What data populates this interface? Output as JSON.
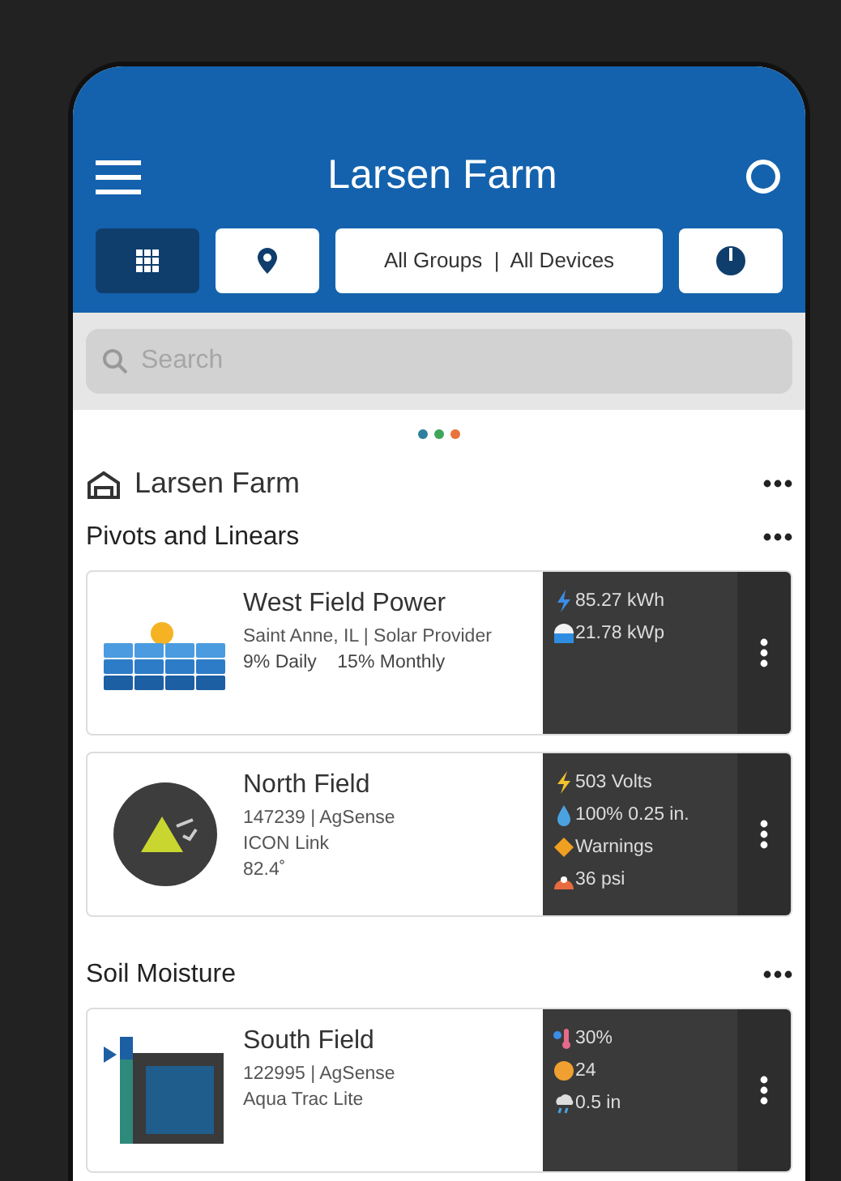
{
  "header": {
    "title": "Larsen Farm"
  },
  "toolbar": {
    "views": [
      {
        "kind": "grid",
        "selected": true
      },
      {
        "kind": "map",
        "selected": false
      }
    ],
    "filter": "All Groups  |  All Devices"
  },
  "search": {
    "placeholder": "Search"
  },
  "page_dots": [
    {
      "color": "#2f7f9e"
    },
    {
      "color": "#3fa558"
    },
    {
      "color": "#e8743b"
    }
  ],
  "farm": {
    "name": "Larsen Farm"
  },
  "sections": [
    {
      "title": "Pivots and Linears",
      "devices": [
        {
          "kind": "solar",
          "name": "West Field Power",
          "lines": [
            "Saint Anne, IL  |  Solar Provider"
          ],
          "stats": "9% Daily    15% Monthly",
          "readings": [
            {
              "kind": "energy",
              "text": "85.27 kWh"
            },
            {
              "kind": "peak",
              "text": "21.78 kWp"
            }
          ]
        },
        {
          "kind": "pivot",
          "name": "North Field",
          "lines": [
            "147239  |  AgSense",
            "ICON Link",
            "82.4˚"
          ],
          "readings": [
            {
              "kind": "volts",
              "text": "503 Volts"
            },
            {
              "kind": "water",
              "text": "100% 0.25 in."
            },
            {
              "kind": "warning",
              "text": "Warnings"
            },
            {
              "kind": "pressure",
              "text": "36 psi"
            }
          ]
        }
      ]
    },
    {
      "title": "Soil Moisture",
      "devices": [
        {
          "kind": "soil",
          "name": "South Field",
          "lines": [
            "122995  |  AgSense",
            "Aqua Trac Lite"
          ],
          "readings": [
            {
              "kind": "moisture",
              "text": "30%"
            },
            {
              "kind": "sun",
              "text": "24"
            },
            {
              "kind": "rain",
              "text": "0.5 in"
            }
          ]
        }
      ]
    }
  ]
}
